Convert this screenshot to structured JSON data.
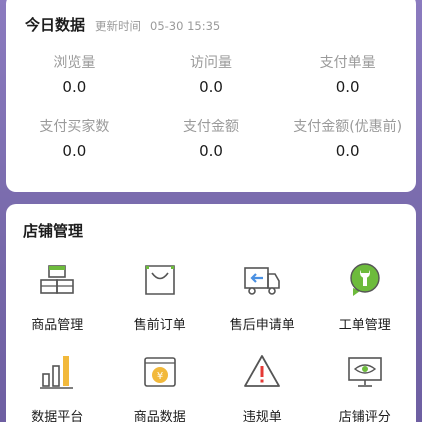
{
  "today": {
    "title": "今日数据",
    "update_label": "更新时间",
    "update_time": "05-30 15:35",
    "stats": [
      {
        "label": "浏览量",
        "value": "0.0"
      },
      {
        "label": "访问量",
        "value": "0.0"
      },
      {
        "label": "支付单量",
        "value": "0.0"
      },
      {
        "label": "支付买家数",
        "value": "0.0"
      },
      {
        "label": "支付金额",
        "value": "0.0"
      },
      {
        "label": "支付金额(优惠前)",
        "value": "0.0"
      }
    ]
  },
  "shop": {
    "title": "店铺管理",
    "items": [
      {
        "label": "商品管理",
        "icon": "boxes-icon"
      },
      {
        "label": "售前订单",
        "icon": "shopping-bag-icon"
      },
      {
        "label": "售后申请单",
        "icon": "return-truck-icon"
      },
      {
        "label": "工单管理",
        "icon": "wrench-icon"
      },
      {
        "label": "数据平台",
        "icon": "bar-chart-icon"
      },
      {
        "label": "商品数据",
        "icon": "yen-coin-icon"
      },
      {
        "label": "违规单",
        "icon": "warning-icon"
      },
      {
        "label": "店铺评分",
        "icon": "eye-monitor-icon"
      }
    ]
  },
  "colors": {
    "background": "#7E6FB0",
    "icon_gray": "#555555",
    "icon_green": "#6DBB3C",
    "icon_yellow": "#F2B93B",
    "icon_blue": "#4A90E2",
    "icon_red": "#E53935"
  }
}
